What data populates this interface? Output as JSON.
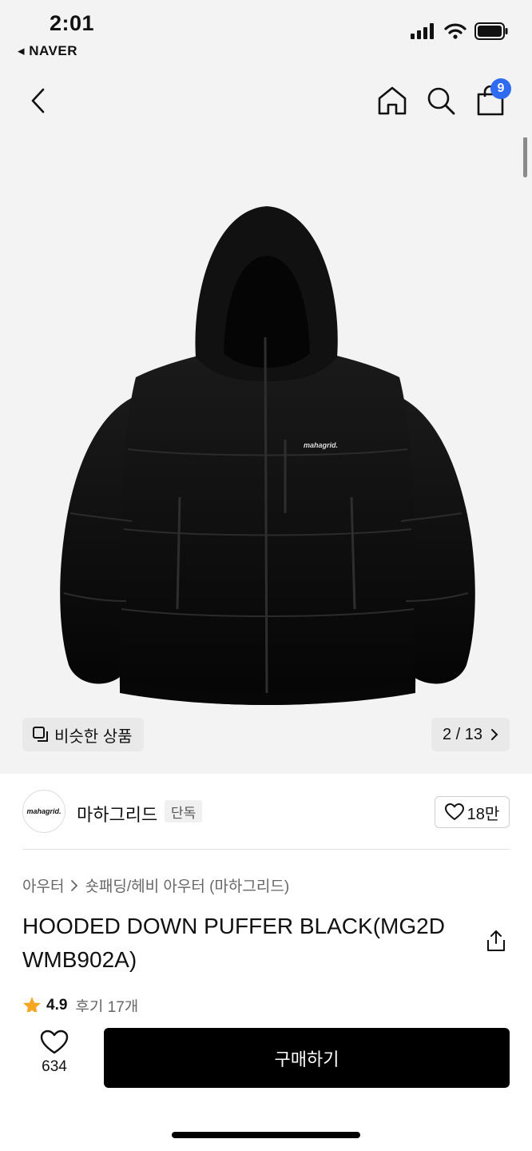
{
  "status_bar": {
    "time": "2:01",
    "back_app": "◂ NAVER"
  },
  "nav": {
    "cart_badge": "9"
  },
  "hero": {
    "brand_print": "mahagrid.",
    "similar_label": "비슷한 상품",
    "page_counter": "2 / 13"
  },
  "brand": {
    "logo_text": "mahagrid.",
    "name": "마하그리드",
    "tag": "단독",
    "likes": "18만"
  },
  "breadcrumb": {
    "level1": "아우터",
    "level2": "숏패딩/헤비 아우터 (마하그리드)"
  },
  "product": {
    "title": "HOODED DOWN PUFFER BLACK(MG2D WMB902A)",
    "rating": "4.9",
    "reviews": "후기 17개"
  },
  "bottom": {
    "wish_count": "634",
    "buy_label": "구매하기"
  },
  "colors": {
    "badge": "#2f6bf0",
    "buy_button": "#000000",
    "star": "#f5a623"
  }
}
